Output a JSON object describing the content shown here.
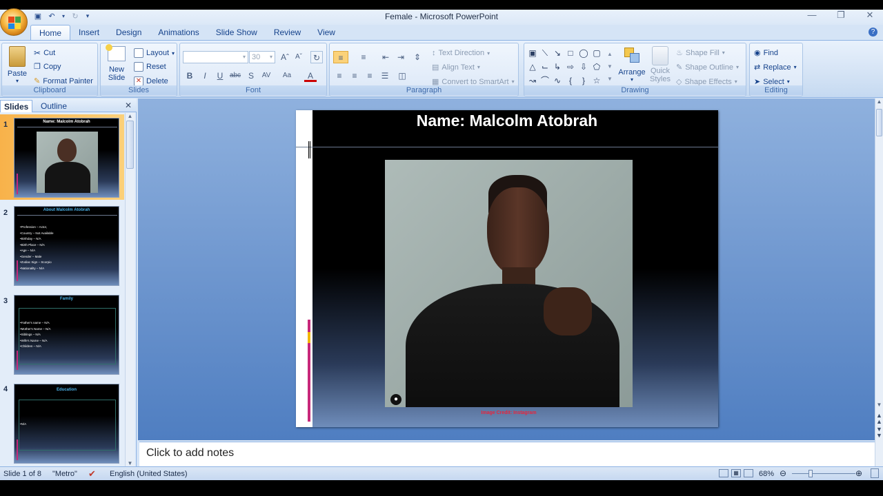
{
  "window": {
    "title": "Female - Microsoft PowerPoint"
  },
  "tabs": [
    "Home",
    "Insert",
    "Design",
    "Animations",
    "Slide Show",
    "Review",
    "View"
  ],
  "ribbon": {
    "clipboard": {
      "label": "Clipboard",
      "paste": "Paste",
      "cut": "Cut",
      "copy": "Copy",
      "format_painter": "Format Painter"
    },
    "slides": {
      "label": "Slides",
      "new_slide": "New Slide",
      "layout": "Layout",
      "reset": "Reset",
      "delete": "Delete"
    },
    "font": {
      "label": "Font",
      "size": "30"
    },
    "paragraph": {
      "label": "Paragraph",
      "text_direction": "Text Direction",
      "align_text": "Align Text",
      "convert_smartart": "Convert to SmartArt"
    },
    "drawing": {
      "label": "Drawing",
      "arrange": "Arrange",
      "quick_styles": "Quick Styles",
      "shape_fill": "Shape Fill",
      "shape_outline": "Shape Outline",
      "shape_effects": "Shape Effects"
    },
    "editing": {
      "label": "Editing",
      "find": "Find",
      "replace": "Replace",
      "select": "Select"
    }
  },
  "pane": {
    "tab_slides": "Slides",
    "tab_outline": "Outline"
  },
  "thumbnails": [
    {
      "num": "1",
      "title": "Name: Malcolm Atobrah",
      "items": []
    },
    {
      "num": "2",
      "title": "About Malcolm Atobrah",
      "items": [
        "Profession – Actor,",
        "Country – Not Available",
        "Birthday – N/A",
        "Birth Place – N/A",
        "Age – N/A",
        "Gender – Male",
        "Zodiac Sign – Scorpio",
        "Nationality – N/A"
      ]
    },
    {
      "num": "3",
      "title": "Family",
      "items": [
        "Father's name – N/A",
        "Mother's Name – N/A",
        "Siblings – N/A",
        "Wife's Name – N/A",
        "Children – N/A"
      ]
    },
    {
      "num": "4",
      "title": "Education",
      "items": [
        "N/A"
      ]
    }
  ],
  "slide": {
    "title": "Name: Malcolm Atobrah",
    "credit": "Image Credit: Instagram"
  },
  "notes": {
    "placeholder": "Click to add notes"
  },
  "status": {
    "slide_info": "Slide 1 of 8",
    "theme": "\"Metro\"",
    "language": "English (United States)",
    "zoom": "68%"
  }
}
